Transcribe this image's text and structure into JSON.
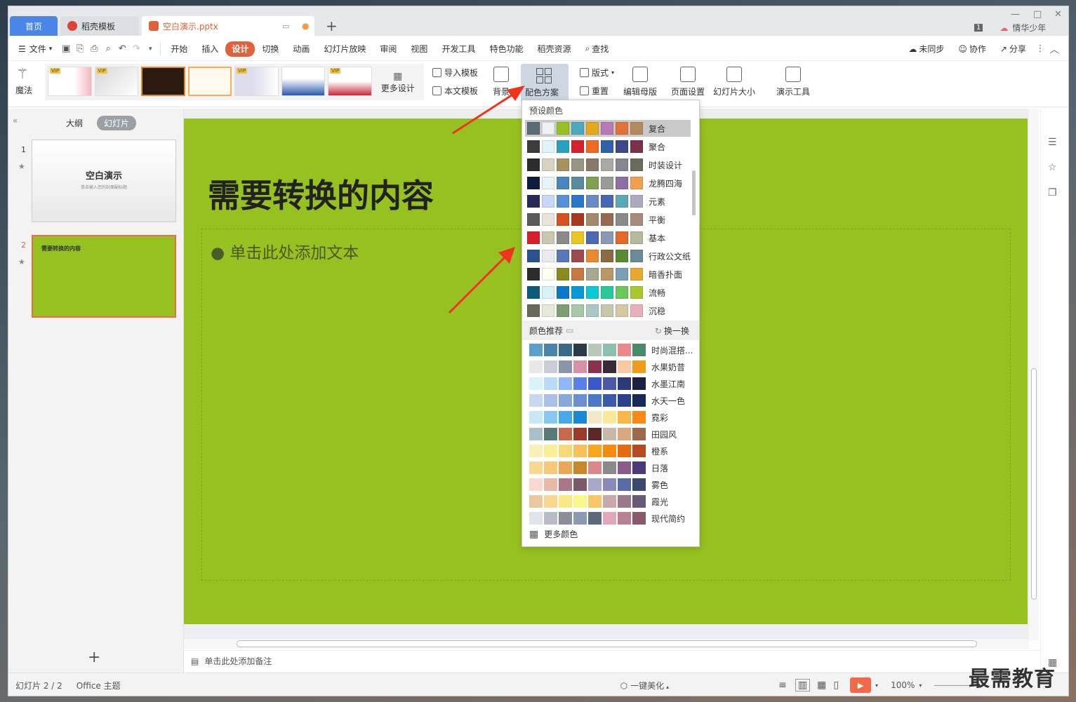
{
  "tabs": {
    "home": "首页",
    "template": "稻壳模板",
    "doc": "空白演示.pptx"
  },
  "user": {
    "badge": "1",
    "name": "情华少年"
  },
  "menu": {
    "file": "文件",
    "items": [
      "开始",
      "插入",
      "设计",
      "切换",
      "动画",
      "幻灯片放映",
      "审阅",
      "视图",
      "开发工具",
      "特色功能",
      "稻壳资源"
    ],
    "active": "设计",
    "search": "查找",
    "sync": "未同步",
    "collab": "协作",
    "share": "分享"
  },
  "ribbon": {
    "magic": "魔法",
    "more_design": "更多设计",
    "import_tpl": "导入模板",
    "text_tpl": "本文模板",
    "background": "背景",
    "color_scheme": "配色方案",
    "layout": "版式",
    "reset": "重置",
    "edit_master": "编辑母版",
    "page_setup": "页面设置",
    "slide_size": "幻灯片大小",
    "present_tools": "演示工具",
    "vip": "VIP"
  },
  "left": {
    "outline": "大纲",
    "slides": "幻灯片",
    "slide1_num": "1",
    "slide1_title": "空白演示",
    "slide1_sub": "单击输入您的封面副标题",
    "slide2_num": "2",
    "slide2_title": "需要转换的内容"
  },
  "slide": {
    "title": "需要转换的内容",
    "placeholder": "单击此处添加文本"
  },
  "notes": "单击此处添加备注",
  "status": {
    "slide_info": "幻灯片 2 / 2",
    "theme": "Office 主题",
    "beautify": "一键美化",
    "zoom": "100%"
  },
  "dropdown": {
    "preset_title": "预设颜色",
    "presets": [
      {
        "name": "复合",
        "colors": [
          "#5d6b75",
          "#eef1f1",
          "#96c121",
          "#4ba9bd",
          "#e7a71b",
          "#b979b6",
          "#e0733a",
          "#b38a5b"
        ]
      },
      {
        "name": "聚合",
        "colors": [
          "#3c3c3c",
          "#dff3f9",
          "#2aa0bf",
          "#d8212c",
          "#ef6a22",
          "#2f63a8",
          "#3c4a8a",
          "#7a3248"
        ]
      },
      {
        "name": "时装设计",
        "colors": [
          "#2c2c2c",
          "#d8d2c0",
          "#a8905f",
          "#9a9580",
          "#8a7868",
          "#aaaaa4",
          "#848692",
          "#6e6a5a"
        ]
      },
      {
        "name": "龙腾四海",
        "colors": [
          "#0f1e3c",
          "#e8f2fb",
          "#4a85c0",
          "#5a8aa0",
          "#7fa050",
          "#9a9a9a",
          "#8f6ea7",
          "#f0a050"
        ]
      },
      {
        "name": "元素",
        "colors": [
          "#252a56",
          "#c8d6fa",
          "#5890d8",
          "#2a78c8",
          "#6a8ac6",
          "#4a66b8",
          "#5aa8b8",
          "#b0a8c0"
        ]
      },
      {
        "name": "平衡",
        "colors": [
          "#5a5a5a",
          "#eae4d8",
          "#d8501e",
          "#aa3820",
          "#a48a6a",
          "#9a6a50",
          "#8a8a8a",
          "#aa8a7a"
        ]
      },
      {
        "name": "基本",
        "colors": [
          "#d8202c",
          "#cac6b0",
          "#8a8a8a",
          "#e8c820",
          "#4a6ab4",
          "#8a9ab4",
          "#e8682a",
          "#b8b89a"
        ]
      },
      {
        "name": "行政公文纸",
        "colors": [
          "#2a5490",
          "#e8eaf0",
          "#5a78b8",
          "#a04a50",
          "#e88a30",
          "#8a6a40",
          "#5a8a30",
          "#6a8a9a"
        ]
      },
      {
        "name": "暗香扑面",
        "colors": [
          "#2c2c2c",
          "#fdfdf0",
          "#8a8a1e",
          "#c87840",
          "#a8a890",
          "#b8986a",
          "#7aa0b8",
          "#e8a830"
        ]
      },
      {
        "name": "流畅",
        "colors": [
          "#0a5a78",
          "#d8f0f8",
          "#0a78c8",
          "#0a98d8",
          "#0ac8d8",
          "#2ac89a",
          "#6ac85a",
          "#a8c830"
        ]
      },
      {
        "name": "沉稳",
        "colors": [
          "#6a6a5a",
          "#e8e8d8",
          "#7aa070",
          "#a8c8a8",
          "#a8c8c8",
          "#c8c8a8",
          "#d8c8a0",
          "#e8b0b8"
        ]
      }
    ],
    "recommend_title": "颜色推荐",
    "refresh": "换一换",
    "recommend": [
      {
        "name": "时尚混搭...",
        "colors": [
          "#5aa0c8",
          "#4a84a8",
          "#3a6a8a",
          "#2a3a4a",
          "#b8c8b8",
          "#8ac0b0",
          "#e88a8a",
          "#4a8a6a"
        ]
      },
      {
        "name": "水果奶昔",
        "colors": [
          "#e8e8ea",
          "#c8ccd8",
          "#8a96a8",
          "#d890a8",
          "#8a3050",
          "#3a2a38",
          "#f8c8a0",
          "#f09a1a"
        ]
      },
      {
        "name": "水墨江南",
        "colors": [
          "#d8f4fa",
          "#b8dcf8",
          "#90b8f8",
          "#5a80e8",
          "#3a58c8",
          "#4a5aa8",
          "#2a3a78",
          "#1a2240"
        ]
      },
      {
        "name": "水天一色",
        "colors": [
          "#c8d8f0",
          "#a8c0e8",
          "#88a8d8",
          "#6a90d0",
          "#4a78c8",
          "#3a5aa8",
          "#2a4088",
          "#1a2a58"
        ]
      },
      {
        "name": "霓彩",
        "colors": [
          "#c8e8f8",
          "#88c8f0",
          "#48a8e8",
          "#1a88d0",
          "#f0e8c8",
          "#f8e898",
          "#f8b848",
          "#f88a1a"
        ]
      },
      {
        "name": "田园风",
        "colors": [
          "#a8c0c8",
          "#5a7a78",
          "#c8684a",
          "#9a3a28",
          "#5a2a28",
          "#c8b8a8",
          "#d8a880",
          "#9a6a4a"
        ]
      },
      {
        "name": "橙系",
        "colors": [
          "#f8f0b8",
          "#f8f098",
          "#f8d878",
          "#f8c058",
          "#f8a820",
          "#f88a10",
          "#e86a10",
          "#b84a20"
        ]
      },
      {
        "name": "日落",
        "colors": [
          "#f8d890",
          "#f8c878",
          "#e8a858",
          "#c8882a",
          "#d88a8a",
          "#8a8a88",
          "#8a5a8a",
          "#4a3a78"
        ]
      },
      {
        "name": "雾色",
        "colors": [
          "#f8d8d0",
          "#e8b8a8",
          "#a87888",
          "#7a5a6a",
          "#a8a8c8",
          "#8a8ab8",
          "#5a6aa8",
          "#3a4a6a"
        ]
      },
      {
        "name": "霞光",
        "colors": [
          "#e8c8a0",
          "#f8d890",
          "#f8e888",
          "#f8f888",
          "#f8c868",
          "#c8a8a8",
          "#9a7a8a",
          "#6a5a7a"
        ]
      },
      {
        "name": "现代简约",
        "colors": [
          "#e0e4ea",
          "#b8bcc8",
          "#8a8e98",
          "#8a9ab0",
          "#5a6a7a",
          "#e0a8b8",
          "#b88090",
          "#8a5a6a"
        ]
      }
    ],
    "more_colors": "更多颜色"
  },
  "watermark": "最需教育",
  "colors": {
    "accent": "#e0623a",
    "home_tab": "#4a86e8",
    "slide_bg": "#96c121"
  }
}
